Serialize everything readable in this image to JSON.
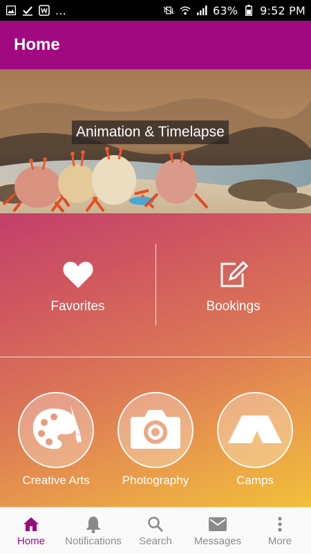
{
  "status_bar": {
    "battery": "63%",
    "time": "9:52 PM",
    "left_icons": [
      "image-notification-icon",
      "check-notification-icon",
      "app-notification-icon",
      "more-notifications-icon"
    ],
    "more_label": "...",
    "right_icons": [
      "vibrate-mute-icon",
      "wifi-icon",
      "signal-icon",
      "battery-icon"
    ]
  },
  "app_bar": {
    "title": "Home"
  },
  "banner": {
    "caption": "Animation & Timelapse"
  },
  "quick_actions": [
    {
      "label": "Favorites",
      "icon": "heart-icon"
    },
    {
      "label": "Bookings",
      "icon": "edit-note-icon"
    }
  ],
  "categories": [
    {
      "label": "Creative Arts",
      "icon": "palette-icon"
    },
    {
      "label": "Photography",
      "icon": "camera-icon"
    },
    {
      "label": "Camps",
      "icon": "tent-icon"
    }
  ],
  "bottom_nav": {
    "items": [
      {
        "label": "Home",
        "icon": "home-icon",
        "active": true
      },
      {
        "label": "Notifications",
        "icon": "bell-icon",
        "active": false
      },
      {
        "label": "Search",
        "icon": "search-icon",
        "active": false
      },
      {
        "label": "Messages",
        "icon": "mail-icon",
        "active": false
      },
      {
        "label": "More",
        "icon": "more-vertical-icon",
        "active": false
      }
    ]
  },
  "colors": {
    "app_bar": "#a0097f",
    "active_nav": "#9c0b7d",
    "inactive_nav": "#8a8a8a",
    "gradient_start": "#c23f6c",
    "gradient_end": "#f2c03a"
  }
}
